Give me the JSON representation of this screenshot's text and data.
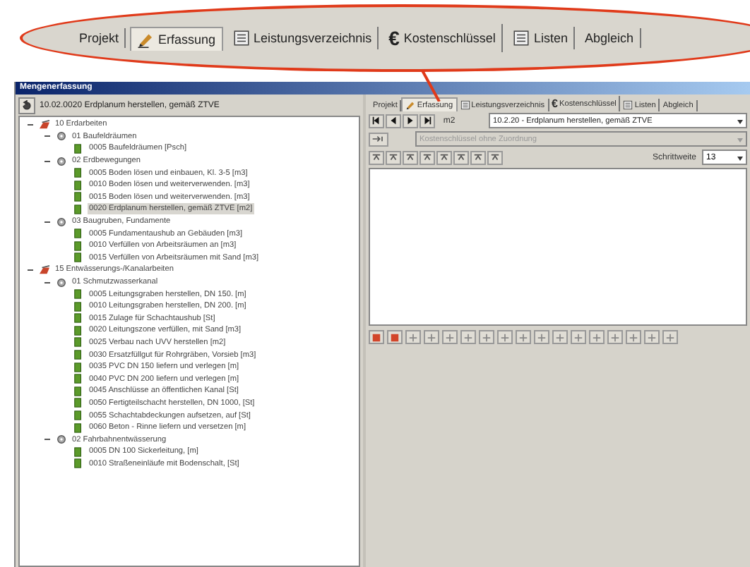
{
  "callout": {
    "tabs": [
      {
        "label": "Projekt",
        "selected": false
      },
      {
        "label": "Erfassung",
        "kind": "pencil",
        "selected": true
      },
      {
        "label": "Leistungsverzeichnis",
        "kind": "list",
        "selected": false
      },
      {
        "label": "Kostenschlüssel",
        "symbol": "€",
        "selected": false
      },
      {
        "label": "Listen",
        "kind": "list",
        "selected": false
      },
      {
        "label": "Abgleich",
        "selected": false
      }
    ]
  },
  "window": {
    "title": "Mengenerfassung"
  },
  "left": {
    "header": "10.02.0020 Erdplanum herstellen, gemäß ZTVE",
    "tree": [
      {
        "kind": "section",
        "label": "10 Erdarbeiten",
        "expanded": true,
        "children": [
          {
            "kind": "group",
            "label": "01 Baufeldräumen",
            "expanded": true,
            "children": [
              {
                "kind": "item",
                "label": "0005 Baufeldräumen [Psch]",
                "selected": false
              }
            ]
          },
          {
            "kind": "group",
            "label": "02 Erdbewegungen",
            "expanded": true,
            "children": [
              {
                "kind": "item",
                "label": "0005 Boden lösen und einbauen, Kl. 3-5 [m3]",
                "selected": false
              },
              {
                "kind": "item",
                "label": "0010 Boden lösen und weiterverwenden. [m3]",
                "selected": false
              },
              {
                "kind": "item",
                "label": "0015 Boden lösen und weiterverwenden. [m3]",
                "selected": false
              },
              {
                "kind": "item",
                "label": "0020 Erdplanum herstellen, gemäß ZTVE [m2]",
                "selected": true
              }
            ]
          },
          {
            "kind": "group",
            "label": "03 Baugruben, Fundamente",
            "expanded": true,
            "children": [
              {
                "kind": "item",
                "label": "0005 Fundamentaushub an Gebäuden [m3]",
                "selected": false
              },
              {
                "kind": "item",
                "label": "0010 Verfüllen von Arbeitsräumen an [m3]",
                "selected": false
              },
              {
                "kind": "item",
                "label": "0015 Verfüllen von Arbeitsräumen mit Sand [m3]",
                "selected": false
              }
            ]
          }
        ]
      },
      {
        "kind": "section",
        "label": "15 Entwässerungs-/Kanalarbeiten",
        "expanded": true,
        "children": [
          {
            "kind": "group",
            "label": "01 Schmutzwasserkanal",
            "expanded": true,
            "children": [
              {
                "kind": "item",
                "label": "0005 Leitungsgraben herstellen, DN 150. [m]",
                "selected": false
              },
              {
                "kind": "item",
                "label": "0010 Leitungsgraben herstellen, DN 200. [m]",
                "selected": false
              },
              {
                "kind": "item",
                "label": "0015 Zulage für Schachtaushub [St]",
                "selected": false
              },
              {
                "kind": "item",
                "label": "0020 Leitungszone verfüllen, mit Sand [m3]",
                "selected": false
              },
              {
                "kind": "item",
                "label": "0025 Verbau nach UVV herstellen [m2]",
                "selected": false
              },
              {
                "kind": "item",
                "label": "0030 Ersatzfüllgut für Rohrgräben, Vorsieb [m3]",
                "selected": false
              },
              {
                "kind": "item",
                "label": "0035 PVC DN 150 liefern und verlegen [m]",
                "selected": false
              },
              {
                "kind": "item",
                "label": "0040 PVC DN 200 liefern und verlegen [m]",
                "selected": false
              },
              {
                "kind": "item",
                "label": "0045 Anschlüsse an öffentlichen Kanal [St]",
                "selected": false
              },
              {
                "kind": "item",
                "label": "0050 Fertigteilschacht herstellen, DN 1000, [St]",
                "selected": false
              },
              {
                "kind": "item",
                "label": "0055 Schachtabdeckungen aufsetzen, auf [St]",
                "selected": false
              },
              {
                "kind": "item",
                "label": "0060 Beton - Rinne liefern und versetzen [m]",
                "selected": false
              }
            ]
          },
          {
            "kind": "group",
            "label": "02 Fahrbahnentwässerung",
            "expanded": true,
            "children": [
              {
                "kind": "item",
                "label": "0005 DN 100 Sickerleitung, [m]",
                "selected": false
              },
              {
                "kind": "item",
                "label": "0010 Straßeneinläufe mit Bodenschalt, [St]",
                "selected": false
              }
            ]
          }
        ]
      }
    ]
  },
  "right": {
    "tabs": [
      {
        "label": "Projekt",
        "selected": false
      },
      {
        "label": "Erfassung",
        "kind": "pencil",
        "selected": true
      },
      {
        "label": "Leistungsverzeichnis",
        "kind": "list",
        "selected": false
      },
      {
        "label": "Kostenschlüssel",
        "symbol": "€",
        "selected": false
      },
      {
        "label": "Listen",
        "kind": "list",
        "selected": false
      },
      {
        "label": "Abgleich",
        "selected": false
      }
    ],
    "unit": "m2",
    "position": {
      "value": "10.2.20 - Erdplanum herstellen, gemäß ZTVE"
    },
    "cost_key": {
      "value": "Kostenschlüssel ohne Zuordnung",
      "disabled": true
    },
    "step": {
      "label": "Schrittweite",
      "value": "13"
    }
  }
}
